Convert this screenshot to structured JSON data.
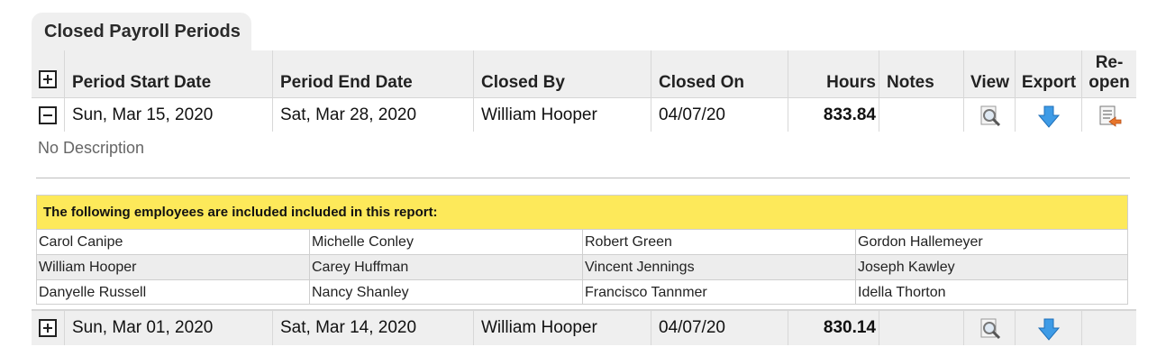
{
  "section_tab": {
    "label": "Closed Payroll Periods"
  },
  "table": {
    "headers": {
      "period_start": "Period Start Date",
      "period_end": "Period End Date",
      "closed_by": "Closed By",
      "closed_on": "Closed On",
      "hours": "Hours",
      "notes": "Notes",
      "view": "View",
      "export": "Export",
      "reopen_line1": "Re-",
      "reopen_line2": "open"
    },
    "rows": [
      {
        "expanded": true,
        "period_start": "Sun, Mar 15, 2020",
        "period_end": "Sat, Mar 28, 2020",
        "closed_by": "William Hooper",
        "closed_on": "04/07/20",
        "hours": "833.84",
        "notes": "",
        "description": "No Description",
        "employees_heading": "The following employees are included included in this report:",
        "employees": [
          [
            "Carol Canipe",
            "Michelle Conley",
            "Robert Green",
            "Gordon Hallemeyer"
          ],
          [
            "William Hooper",
            "Carey Huffman",
            "Vincent Jennings",
            "Joseph Kawley"
          ],
          [
            "Danyelle Russell",
            "Nancy Shanley",
            "Francisco Tannmer",
            "Idella Thorton"
          ]
        ]
      },
      {
        "expanded": false,
        "period_start": "Sun, Mar 01, 2020",
        "period_end": "Sat, Mar 14, 2020",
        "closed_by": "William Hooper",
        "closed_on": "04/07/20",
        "hours": "830.14",
        "notes": ""
      }
    ]
  },
  "icons": {
    "expand_all": "plus-box-icon",
    "collapse": "minus-box-icon",
    "expand": "plus-box-icon",
    "view": "magnifier-report-icon",
    "export": "blue-down-arrow-icon",
    "reopen": "document-reopen-icon"
  }
}
